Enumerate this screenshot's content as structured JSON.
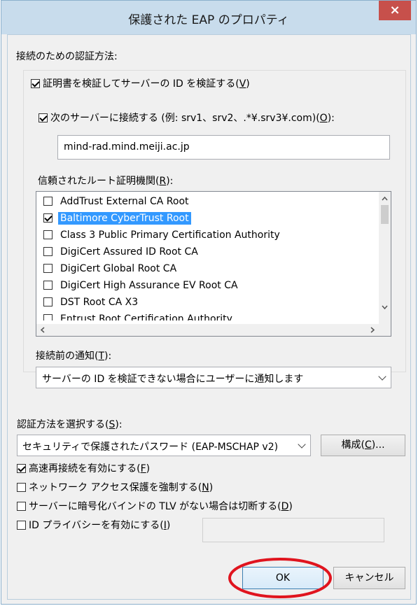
{
  "window": {
    "title": "保護された EAP のプロパティ",
    "close_glyph": "×"
  },
  "auth_section": {
    "label": "接続のための認証方法:",
    "verify_cert": {
      "checked": true,
      "prefix": "証明書を検証してサーバーの ID を検証する(",
      "key": "V",
      "suffix": ")"
    },
    "connect_servers": {
      "checked": true,
      "prefix": "次のサーバーに接続する (例: srv1、srv2、.*¥.srv3¥.com)(",
      "key": "O",
      "suffix": "):"
    },
    "server_value": "mind-rad.mind.meiji.ac.jp",
    "trusted_root": {
      "prefix": "信頼されたルート証明機関(",
      "key": "R",
      "suffix": "):"
    },
    "root_cas": [
      {
        "label": "AddTrust External CA Root",
        "checked": false,
        "selected": false
      },
      {
        "label": "Baltimore CyberTrust Root",
        "checked": true,
        "selected": true
      },
      {
        "label": "Class 3 Public Primary Certification Authority",
        "checked": false,
        "selected": false
      },
      {
        "label": "DigiCert Assured ID Root CA",
        "checked": false,
        "selected": false
      },
      {
        "label": "DigiCert Global Root CA",
        "checked": false,
        "selected": false
      },
      {
        "label": "DigiCert High Assurance EV Root CA",
        "checked": false,
        "selected": false
      },
      {
        "label": "DST Root CA X3",
        "checked": false,
        "selected": false
      },
      {
        "label": "Entrust Root Certification Authority",
        "checked": false,
        "selected": false
      }
    ],
    "notify": {
      "prefix": "接続前の通知(",
      "key": "T",
      "suffix": "):"
    },
    "notify_value": "サーバーの ID を検証できない場合にユーザーに通知します"
  },
  "method": {
    "label": {
      "prefix": "認証方法を選択する(",
      "key": "S",
      "suffix": "):"
    },
    "value": "セキュリティで保護されたパスワード (EAP-MSCHAP v2)",
    "configure": {
      "prefix": "構成(",
      "key": "C",
      "suffix": ")..."
    }
  },
  "options": [
    {
      "checked": true,
      "prefix": "高速再接続を有効にする(",
      "key": "F",
      "suffix": ")"
    },
    {
      "checked": false,
      "prefix": "ネットワーク アクセス保護を強制する(",
      "key": "N",
      "suffix": ")"
    },
    {
      "checked": false,
      "prefix": "サーバーに暗号化バインドの TLV がない場合は切断する(",
      "key": "D",
      "suffix": ")"
    },
    {
      "checked": false,
      "prefix": "ID プライバシーを有効にする(",
      "key": "I",
      "suffix": ")"
    }
  ],
  "buttons": {
    "ok": "OK",
    "cancel": "キャンセル"
  },
  "colors": {
    "selection": "#3399ff",
    "close_button": "#c7504b",
    "annotation_circle": "#e0141e"
  }
}
